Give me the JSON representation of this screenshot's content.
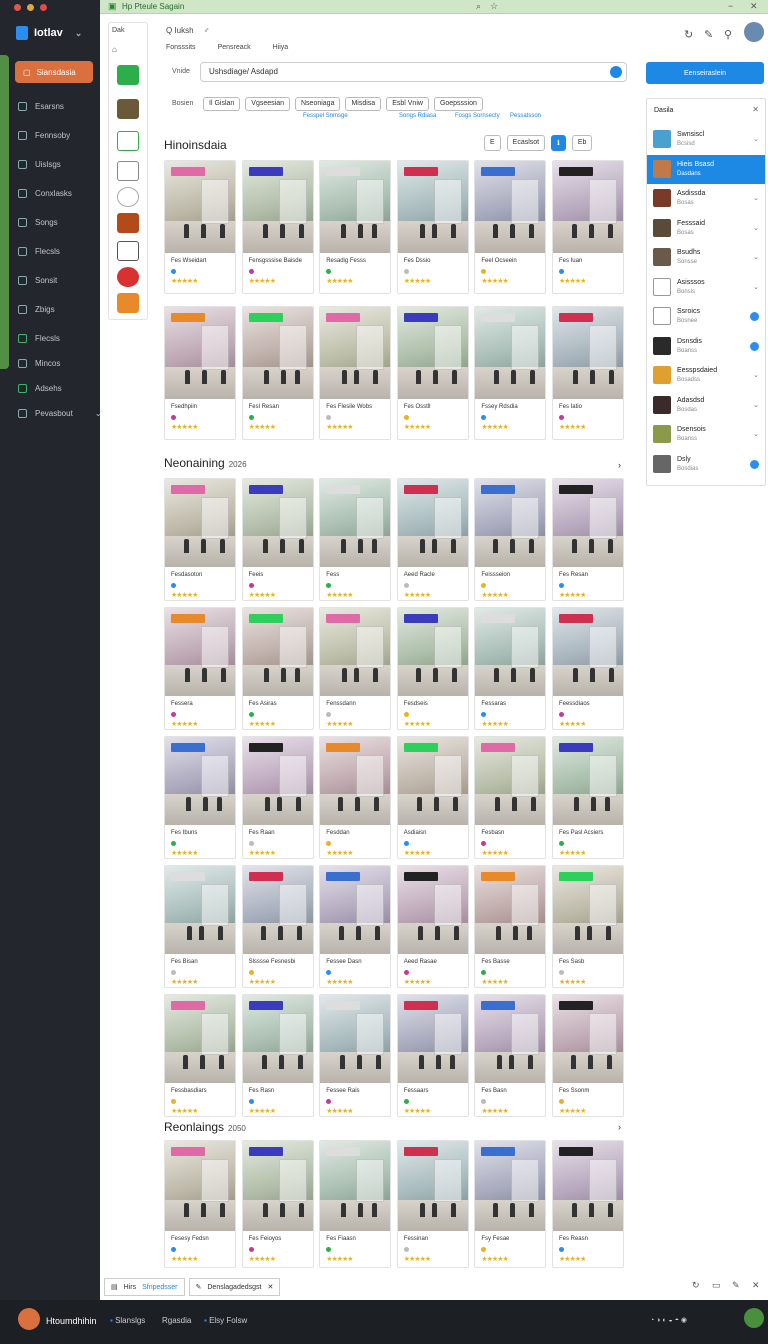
{
  "window": {
    "title": "Hp Pteule Sagain"
  },
  "brand": {
    "name": "Iotlav"
  },
  "sidebar": {
    "active": "Siansdasia",
    "items": [
      "Esarsns",
      "Fennsoby",
      "Uislsgs",
      "Conxlasks",
      "Songs",
      "Flecsls",
      "Sonsit",
      "Zbigs",
      "Flecsls",
      "Mincos",
      "Adsehs",
      "Pevasbout"
    ]
  },
  "toolbar": {
    "label": "Dak"
  },
  "header": {
    "tools": [
      "Q Iuksh",
      "♂"
    ],
    "nav": [
      "Fonsssits",
      "Pensreack",
      "Hiiya"
    ],
    "view_label": "Vnide",
    "section_label": "Bosien",
    "search_value": "Ushsdiage/ Asdapd",
    "primary_button": "Eenseiraslein"
  },
  "filters": [
    {
      "label": "Il Gislan"
    },
    {
      "label": "Vgseesian"
    },
    {
      "label": "Nseoniaga"
    },
    {
      "label": "Misdisa"
    },
    {
      "label": "Esbl Vniw"
    },
    {
      "label": "Goepsssion"
    }
  ],
  "filter_subs": [
    "Fesspel Snmsge",
    "Songs Rdiasa",
    "Fosgs Sornsecty",
    "Pessatsson"
  ],
  "sections": [
    {
      "title": "Hinoinsdaia",
      "subtitle": ""
    },
    {
      "title": "Neonaining",
      "subtitle": "2026"
    },
    {
      "title": "Reonlaings",
      "subtitle": "2050"
    }
  ],
  "view_tools": [
    "E",
    "Ecaslsot",
    "ℹ",
    "Eb"
  ],
  "grid1": [
    [
      "Fes Wseidart",
      "Fensgsssise Baisde",
      "Resadig Fesss",
      "Fes Dssio",
      "Feel Ocseein",
      "Fes Iuan"
    ],
    [
      "Fsedhpiin",
      "Fesl Resan",
      "Fes Flesile Wobs",
      "Fes Osstll",
      "Fssey Rdsdia",
      "Fes Iatio"
    ]
  ],
  "grid2": [
    [
      "Fesdasoton",
      "Feeis",
      "Fess",
      "Aeed Racle",
      "Feissseion",
      "Fes Resan"
    ],
    [
      "Fessera",
      "Fes Asiras",
      "Fenssdann",
      "Fesdseis",
      "Fessaras",
      "Feessdiaos"
    ],
    [
      "Fes Ibuns",
      "Fes Raan",
      "Fesddan",
      "Asdiaisn",
      "Fesbasn",
      "Fes Pasl Acsiers"
    ],
    [
      "Fes Bisan",
      "Slsssse Fesnesbi",
      "Fessee Dasn",
      "Aeed Rasae",
      "Fes Basse",
      "Fes Sasb"
    ],
    [
      "Fessbasdiars",
      "Fes Rasn",
      "Fessee Rais",
      "Fessaars",
      "Fes Basn",
      "Fes Ssonm"
    ]
  ],
  "grid3": [
    [
      "Fesesy Fedsn",
      "Fes Feioyos",
      "Fes Fiaasn",
      "Fessinan",
      "Fsy Fesae",
      "Fes Reasn"
    ]
  ],
  "right_panel": {
    "title": "Dasila",
    "rows": [
      {
        "name": "Swnsiscl",
        "sub": "Bcsisd"
      },
      {
        "name": "Hieis Bsasd",
        "sub": "Dasdans"
      },
      {
        "name": "Asdissda",
        "sub": "Bosas"
      },
      {
        "name": "Fesssaid",
        "sub": "Bosas"
      },
      {
        "name": "Bsudhs",
        "sub": "Sonsse"
      },
      {
        "name": "Asisssos",
        "sub": "Bonsis"
      },
      {
        "name": "Ssroics",
        "sub": "Bosnee"
      },
      {
        "name": "Dsnsdis",
        "sub": "Boanss"
      },
      {
        "name": "Eesspsdaied",
        "sub": "Bosadss"
      },
      {
        "name": "Adasdsd",
        "sub": "Bosdas"
      },
      {
        "name": "Dsensois",
        "sub": "Boanss"
      },
      {
        "name": "Dsly",
        "sub": "Bosdias"
      }
    ]
  },
  "bottom_tabs": [
    {
      "label": "Hirs",
      "accent": "Sfnpedsser"
    },
    {
      "label": "Denslagadedsgst",
      "accent": ""
    }
  ],
  "taskbar": {
    "name": "Htoumdhihin",
    "apps": [
      "Slanslgs",
      "Rgasdia",
      "Elsy Folsw"
    ]
  },
  "colors": {
    "accent": "#1e88e5",
    "active_side": "#d9703e",
    "star": "#e6b422"
  }
}
